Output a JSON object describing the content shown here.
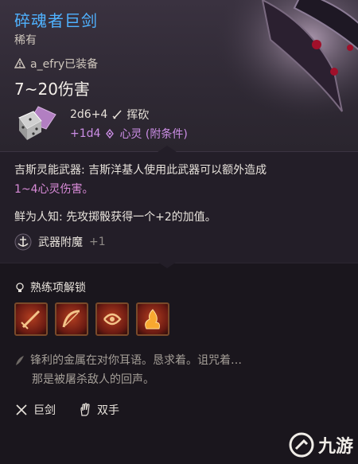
{
  "item": {
    "name": "碎魂者巨剑",
    "rarity": "稀有",
    "equipped_by": "a_efry已装备",
    "damage_range": "7~20伤害",
    "base_damage": "2d6+4",
    "base_damage_type": "挥砍",
    "bonus_damage": "+1d4",
    "bonus_damage_type": "心灵 (附条件)"
  },
  "description": {
    "ability_text": "吉斯灵能武器: 吉斯洋基人使用此武器可以额外造成",
    "ability_highlight": "1~4心灵伤害。",
    "lore_text": "鲜为人知: 先攻掷骰获得一个+2的加值。",
    "enchant_label": "武器附魔",
    "enchant_value": "+1"
  },
  "proficiency": {
    "label": "熟练项解锁",
    "skills": [
      {
        "icon": "sword-strike-skill-icon"
      },
      {
        "icon": "bow-swing-skill-icon"
      },
      {
        "icon": "cleave-skill-icon"
      },
      {
        "icon": "fire-slash-skill-icon"
      }
    ]
  },
  "flavor": {
    "line1": "锋利的金属在对你耳语。恳求着。诅咒着…",
    "line2": "那是被屠杀敌人的回声。"
  },
  "properties": {
    "type": "巨剑",
    "handedness": "双手"
  },
  "watermark": {
    "text": "九游"
  },
  "colors": {
    "title": "#4fb2ff",
    "psychic": "#cc8ee6",
    "highlight": "#d98bd8"
  }
}
